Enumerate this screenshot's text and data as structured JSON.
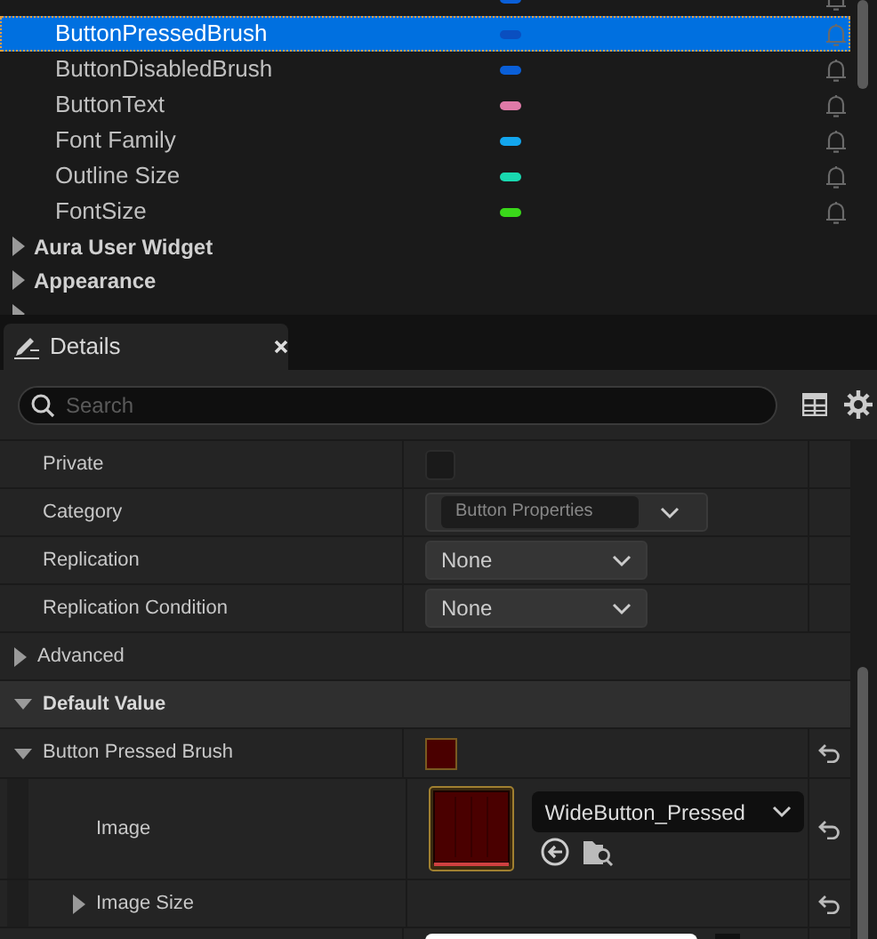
{
  "variables": [
    {
      "color": "#0a5fd8",
      "selected": false
    },
    {
      "name": "ButtonPressedBrush",
      "color": "#0a4fc0",
      "selected": true
    },
    {
      "name": "ButtonDisabledBrush",
      "color": "#0a5fd8",
      "selected": false
    },
    {
      "name": "ButtonText",
      "color": "#e07aa8",
      "selected": false
    },
    {
      "name": "Font Family",
      "color": "#13a6ee",
      "selected": false
    },
    {
      "name": "Outline Size",
      "color": "#19d9b0",
      "selected": false
    },
    {
      "name": "FontSize",
      "color": "#3ad81a",
      "selected": false
    }
  ],
  "categories": [
    {
      "label": "Aura User Widget",
      "expanded": false
    },
    {
      "label": "Appearance",
      "expanded": false
    },
    {
      "expanded": false
    }
  ],
  "details": {
    "tab": {
      "title": "Details"
    },
    "search": {
      "placeholder": "Search"
    },
    "rows": [
      {
        "kind": "checkbox",
        "label": "Private",
        "checked": false
      },
      {
        "kind": "combo",
        "label": "Category",
        "value": "Button Properties",
        "disabled": true
      },
      {
        "kind": "dropdown",
        "label": "Replication",
        "value": "None"
      },
      {
        "kind": "dropdown",
        "label": "Replication Condition",
        "value": "None"
      },
      {
        "kind": "group",
        "label": "Advanced",
        "expanded": false
      },
      {
        "kind": "header",
        "label": "Default Value",
        "expanded": true
      },
      {
        "kind": "brush",
        "label": "Button Pressed Brush",
        "expanded": true,
        "color": "#4a0000",
        "resettable": true
      },
      {
        "kind": "image",
        "label": "Image",
        "value": "WideButton_Pressed",
        "resettable": true
      },
      {
        "kind": "subgroup",
        "label": "Image Size",
        "expanded": false,
        "resettable": true
      },
      {
        "kind": "tint"
      }
    ]
  }
}
